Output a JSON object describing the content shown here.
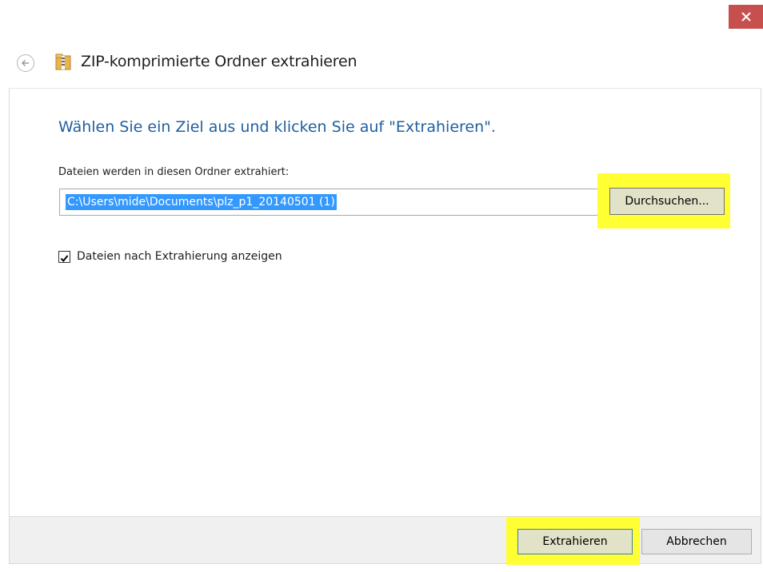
{
  "window": {
    "title": "ZIP-komprimierte Ordner extrahieren",
    "close_icon": "close-icon",
    "back_icon": "back-arrow-icon",
    "title_icon": "zip-folder-icon"
  },
  "main": {
    "heading": "Wählen Sie ein Ziel aus und klicken Sie auf \"Extrahieren\".",
    "destination_label": "Dateien werden in diesen Ordner extrahiert:",
    "destination_value": "C:\\Users\\mide\\Documents\\plz_p1_20140501 (1)",
    "browse_label": "Durchsuchen...",
    "show_files_label": "Dateien nach Extrahierung anzeigen",
    "show_files_checked": true
  },
  "footer": {
    "extract_label": "Extrahieren",
    "cancel_label": "Abbrechen"
  },
  "colors": {
    "heading": "#1f5f9f",
    "highlight": "#ffff33",
    "selection": "#3399ff",
    "close_button": "#c7504f"
  }
}
